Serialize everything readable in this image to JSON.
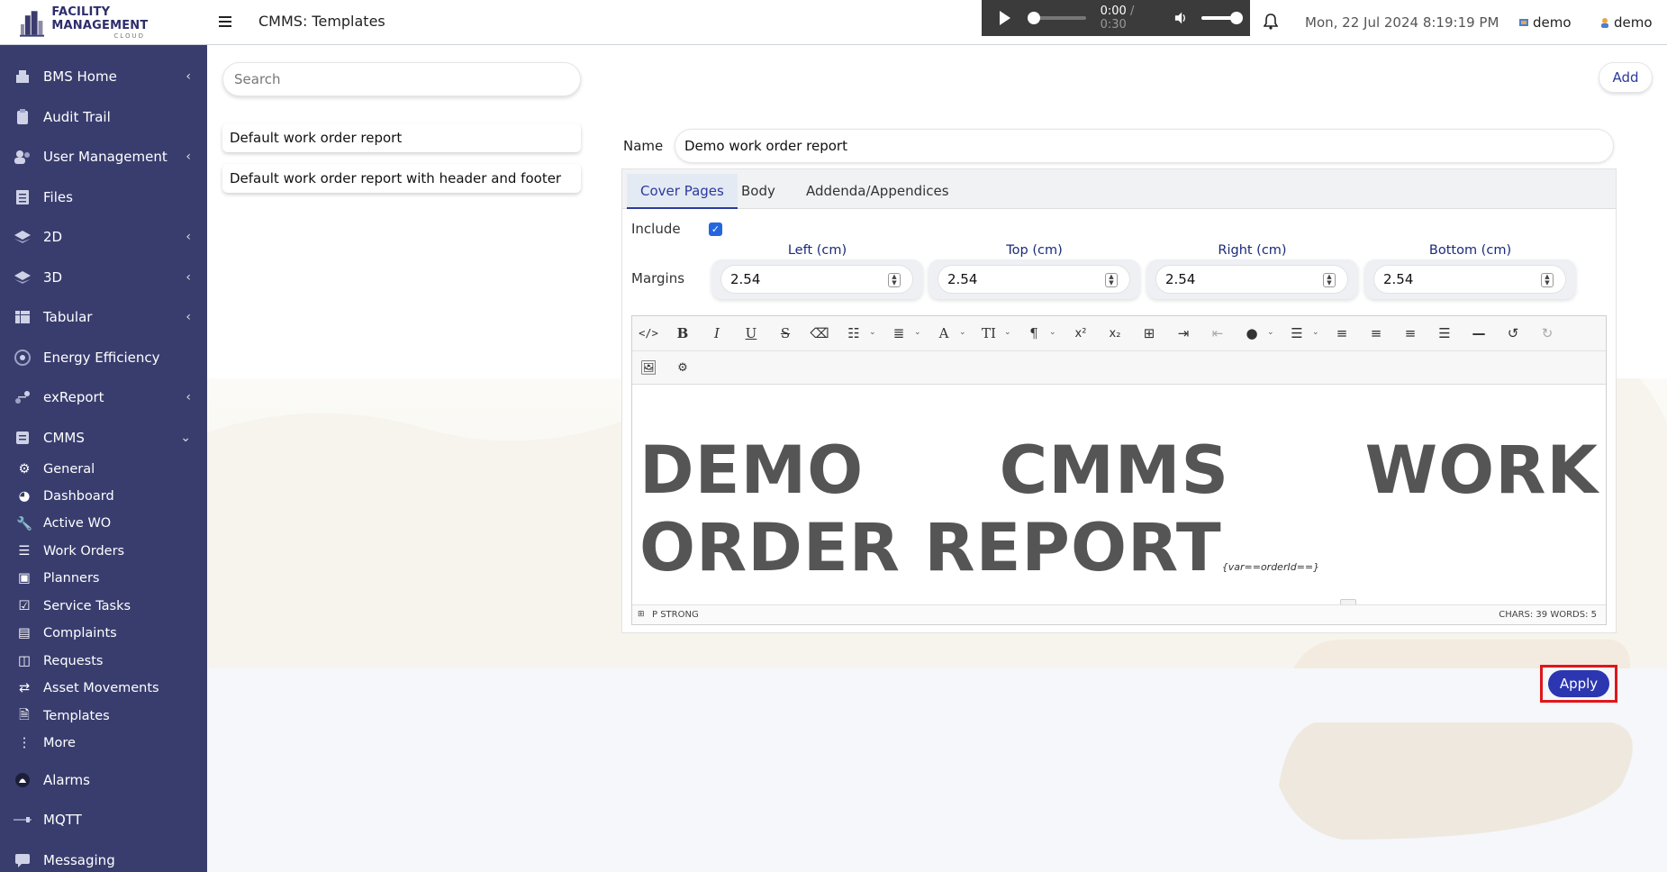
{
  "app": {
    "logo_title": "FACILITY MANAGEMENT",
    "logo_sub": "CLOUD",
    "page_title": "CMMS: Templates"
  },
  "audio": {
    "current": "0:00",
    "separator": "/",
    "duration": "0:30"
  },
  "header": {
    "datetime": "Mon, 22 Jul 2024 8:19:19 PM",
    "site": "demo",
    "user": "demo"
  },
  "sidebar": {
    "items": [
      {
        "label": "BMS Home",
        "icon": "building-icon",
        "chevron": "‹"
      },
      {
        "label": "Audit Trail",
        "icon": "clipboard-icon",
        "chevron": ""
      },
      {
        "label": "User Management",
        "icon": "users-icon",
        "chevron": "‹"
      },
      {
        "label": "Files",
        "icon": "files-icon",
        "chevron": ""
      },
      {
        "label": "2D",
        "icon": "layers-2d-icon",
        "chevron": "‹"
      },
      {
        "label": "3D",
        "icon": "layers-3d-icon",
        "chevron": "‹"
      },
      {
        "label": "Tabular",
        "icon": "table-icon",
        "chevron": "‹"
      },
      {
        "label": "Energy Efficiency",
        "icon": "gauge-icon",
        "chevron": ""
      },
      {
        "label": "exReport",
        "icon": "report-icon",
        "chevron": "‹"
      },
      {
        "label": "CMMS",
        "icon": "cmms-icon",
        "chevron": "⌄"
      }
    ],
    "cmms_sub": [
      {
        "label": "General",
        "icon": "gears-icon"
      },
      {
        "label": "Dashboard",
        "icon": "dashboard-icon"
      },
      {
        "label": "Active WO",
        "icon": "wrench-icon"
      },
      {
        "label": "Work Orders",
        "icon": "list-icon"
      },
      {
        "label": "Planners",
        "icon": "planner-icon"
      },
      {
        "label": "Service Tasks",
        "icon": "check-square-icon"
      },
      {
        "label": "Complaints",
        "icon": "complaint-icon"
      },
      {
        "label": "Requests",
        "icon": "request-icon"
      },
      {
        "label": "Asset Movements",
        "icon": "arrows-icon"
      },
      {
        "label": "Templates",
        "icon": "template-icon"
      },
      {
        "label": "More",
        "icon": "more-vertical-icon"
      }
    ],
    "bottom_items": [
      {
        "label": "Alarms",
        "icon": "alarm-icon"
      },
      {
        "label": "MQTT",
        "icon": "mqtt-icon"
      },
      {
        "label": "Messaging",
        "icon": "message-icon"
      }
    ]
  },
  "search": {
    "placeholder": "Search",
    "value": ""
  },
  "add_label": "Add",
  "templates": [
    "Default work order report",
    "Default work order report with header and footer"
  ],
  "form": {
    "name_label": "Name",
    "name_value": "Demo work order report",
    "tabs": [
      "Cover Pages",
      "Body",
      "Addenda/Appendices"
    ],
    "active_tab": "Cover Pages",
    "include_label": "Include",
    "include_checked": true,
    "margins_label": "Margins",
    "margins": [
      {
        "label": "Left (cm)",
        "value": "2.54"
      },
      {
        "label": "Top (cm)",
        "value": "2.54"
      },
      {
        "label": "Right (cm)",
        "value": "2.54"
      },
      {
        "label": "Bottom (cm)",
        "value": "2.54"
      }
    ]
  },
  "editor": {
    "content_text": "DEMO CMMS WORK ORDER REPORT",
    "variable": "{var==orderId==}",
    "path": "P  STRONG",
    "counts": "CHARS: 39   WORDS: 5"
  },
  "apply_label": "Apply",
  "colors": {
    "sidebar": "#393d6e",
    "accent": "#2c36b0",
    "highlight": "#e0161b"
  }
}
